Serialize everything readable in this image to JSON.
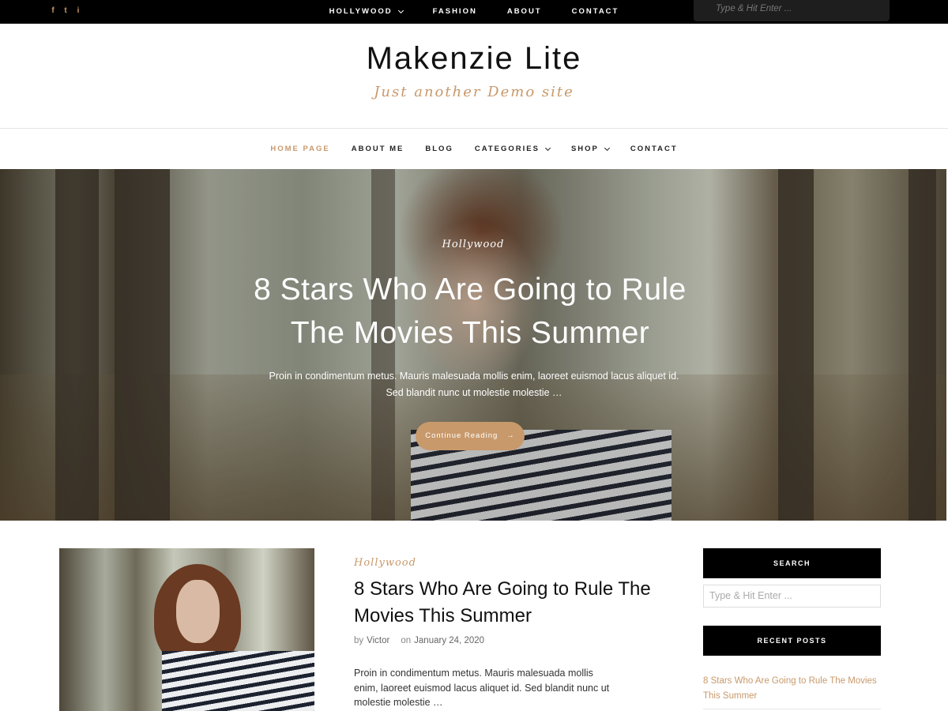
{
  "topbar": {
    "social": [
      "f",
      "t",
      "i"
    ],
    "social_icons": [
      "facebook-icon",
      "twitter-icon",
      "instagram-icon"
    ],
    "nav": [
      {
        "label": "HOLLYWOOD",
        "dropdown": true
      },
      {
        "label": "FASHION"
      },
      {
        "label": "ABOUT"
      },
      {
        "label": "CONTACT"
      }
    ],
    "search_placeholder": "Type & Hit Enter ..."
  },
  "site": {
    "title": "Makenzie Lite",
    "tagline": "Just another Demo site"
  },
  "main_nav": [
    {
      "label": "HOME PAGE",
      "active": true
    },
    {
      "label": "ABOUT ME"
    },
    {
      "label": "BLOG"
    },
    {
      "label": "CATEGORIES",
      "dropdown": true
    },
    {
      "label": "SHOP",
      "dropdown": true
    },
    {
      "label": "CONTACT"
    }
  ],
  "hero": {
    "category": "Hollywood",
    "title": "8 Stars Who Are Going to Rule The Movies This Summer",
    "excerpt": "Proin in condimentum metus. Mauris malesuada mollis enim, laoreet euismod lacus aliquet id. Sed blandit nunc ut molestie molestie …",
    "button": "Continue Reading",
    "button_arrow": "→"
  },
  "post": {
    "category": "Hollywood",
    "title": "8 Stars Who Are Going to Rule The Movies This Summer",
    "by_label": "by",
    "author": "Victor",
    "on_label": "on",
    "date": "January 24, 2020",
    "excerpt": "Proin in condimentum metus. Mauris malesuada mollis enim, laoreet euismod lacus aliquet id. Sed blandit nunc ut molestie molestie …"
  },
  "sidebar": {
    "search_title": "SEARCH",
    "search_placeholder": "Type & Hit Enter ...",
    "recent_title": "RECENT POSTS",
    "recent_posts": [
      "8 Stars Who Are Going to Rule The Movies This Summer"
    ]
  },
  "colors": {
    "accent": "#c8996b",
    "topbar": "#000000"
  }
}
